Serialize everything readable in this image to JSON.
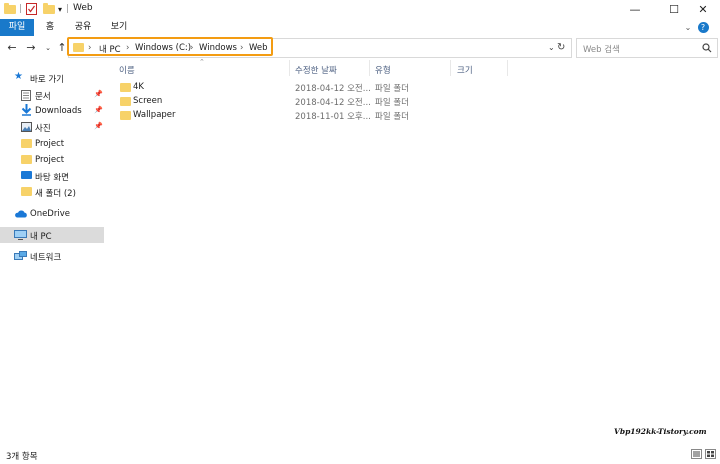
{
  "window": {
    "title": "Web",
    "icon": "folder-icon"
  },
  "titlebar_controls": {
    "minimize": "—",
    "maximize": "☐",
    "close": "✕"
  },
  "ribbon": {
    "tabs": [
      {
        "label": "파일",
        "active": true
      },
      {
        "label": "홈",
        "active": false
      },
      {
        "label": "공유",
        "active": false
      },
      {
        "label": "보기",
        "active": false
      }
    ],
    "help_glyph": "?"
  },
  "address": {
    "breadcrumbs": [
      "내 PC",
      "Windows (C:)",
      "Windows",
      "Web"
    ],
    "highlight_color": "#f39c12"
  },
  "search": {
    "placeholder": "Web 검색"
  },
  "sidebar": {
    "items": [
      {
        "label": "바로 가기",
        "icon": "star-icon"
      },
      {
        "label": "문서",
        "icon": "document-icon",
        "pinned": true
      },
      {
        "label": "Downloads",
        "icon": "download-icon",
        "pinned": true
      },
      {
        "label": "사진",
        "icon": "picture-icon",
        "pinned": true
      },
      {
        "label": "Project",
        "icon": "folder-icon"
      },
      {
        "label": "Project",
        "icon": "folder-icon"
      },
      {
        "label": "바탕 화면",
        "icon": "desktop-icon"
      },
      {
        "label": "새 폴더 (2)",
        "icon": "folder-icon"
      },
      {
        "label": "OneDrive",
        "icon": "cloud-icon"
      },
      {
        "label": "내 PC",
        "icon": "computer-icon",
        "selected": true
      },
      {
        "label": "네트워크",
        "icon": "network-icon"
      }
    ]
  },
  "columns": [
    "이름",
    "수정한 날짜",
    "유형",
    "크기"
  ],
  "files": [
    {
      "name": "4K",
      "date": "2018-04-12 오전...",
      "type": "파일 폴더"
    },
    {
      "name": "Screen",
      "date": "2018-04-12 오전...",
      "type": "파일 폴더"
    },
    {
      "name": "Wallpaper",
      "date": "2018-11-01 오후...",
      "type": "파일 폴더"
    }
  ],
  "status": {
    "item_count": "3개 항목"
  },
  "watermark": "Vbp192kk-Tistory.com",
  "colors": {
    "accent": "#1979ca",
    "folder": "#f7d269",
    "selected": "#dbdbdb"
  }
}
